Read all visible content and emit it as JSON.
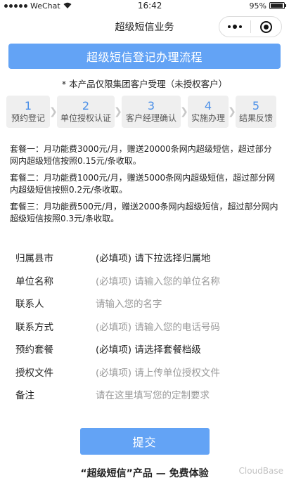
{
  "status_bar": {
    "carrier": "WeChat",
    "time": "16:42",
    "battery": "95%",
    "battery_level": 0.95
  },
  "nav": {
    "title": "超级短信业务"
  },
  "banner": {
    "title": "超级短信登记办理流程"
  },
  "notice": "* 本产品仅限集团客户受理（未授权客户）",
  "steps": [
    {
      "num": "1",
      "label": "预约登记"
    },
    {
      "num": "2",
      "label": "单位授权认证"
    },
    {
      "num": "3",
      "label": "客户经理确认"
    },
    {
      "num": "4",
      "label": "实施办理"
    },
    {
      "num": "5",
      "label": "结果反馈"
    }
  ],
  "packages": [
    "套餐一：月功能费3000元/月，赠送20000条网内超级短信，超过部分网内超级短信按照0.15元/条收取。",
    "套餐二：月功能费1000元/月，赠送5000条网内超级短信，超过部分网内超级短信按照0.2元/条收取。",
    "套餐三：月功能费500元/月，赠送2000条网内超级短信，超过部分网内超级短信按照0.3元/条收取。"
  ],
  "form": [
    {
      "label": "归属县市",
      "value": "(必填项) 请下拉选择归属地"
    },
    {
      "label": "单位名称",
      "value": "(必填项) 请输入您的单位名称"
    },
    {
      "label": "联系人",
      "value": "请输入您的名字"
    },
    {
      "label": "联系方式",
      "value": "(必填项) 请输入您的电话号码"
    },
    {
      "label": "预约套餐",
      "value": "(必填项) 请选择套餐档级"
    },
    {
      "label": "授权文件",
      "value": "(必填项) 请上传单位授权文件"
    },
    {
      "label": "备注",
      "value": "请在这里填写您的定制要求"
    }
  ],
  "submit_label": "提交",
  "footer": "“超级短信”产品 — 免费体验",
  "watermark": "CloudBase"
}
